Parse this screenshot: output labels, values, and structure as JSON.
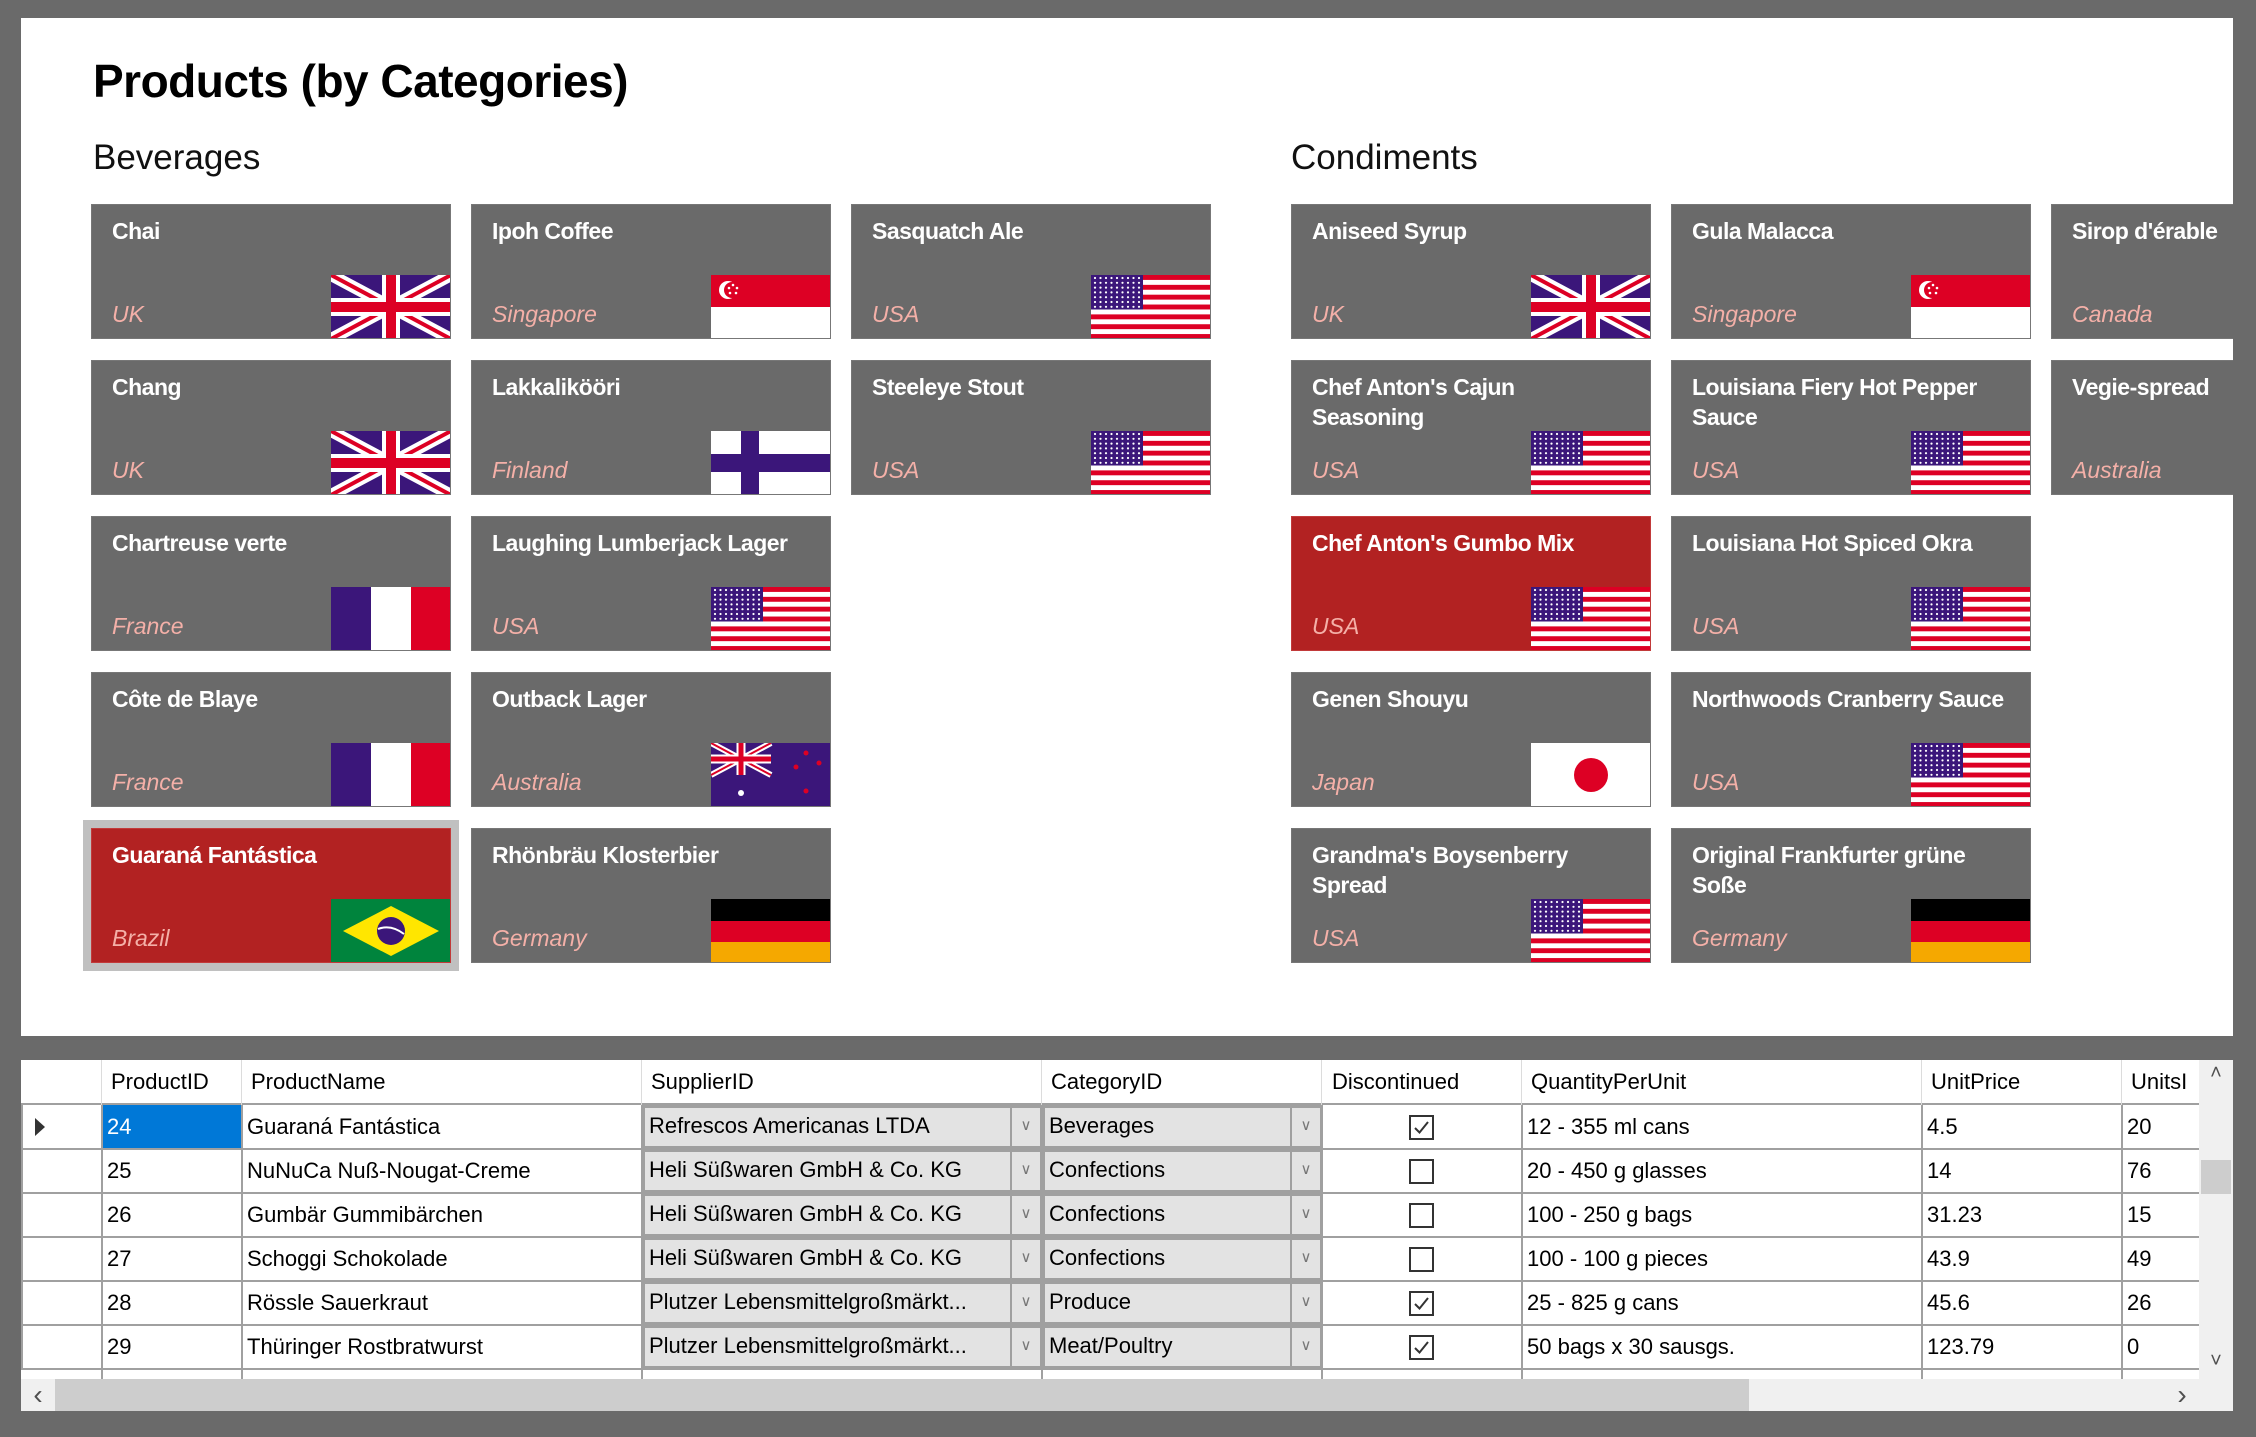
{
  "page": {
    "title": "Products (by Categories)"
  },
  "colors": {
    "tile_bg": "#6a6a6a",
    "tile_selected_bg": "#b22222",
    "tile_name": "#ffffff",
    "tile_country": "#f4b0a8",
    "selected_cell": "#0078d7",
    "window_bg": "#6a6a6a"
  },
  "categories": [
    {
      "name": "Beverages",
      "products": [
        {
          "name": "Chai",
          "country": "UK",
          "flag": "uk-flag-icon",
          "col": 0,
          "row": 0
        },
        {
          "name": "Chang",
          "country": "UK",
          "flag": "uk-flag-icon",
          "col": 0,
          "row": 1
        },
        {
          "name": "Chartreuse verte",
          "country": "France",
          "flag": "france-flag-icon",
          "col": 0,
          "row": 2
        },
        {
          "name": "Côte de Blaye",
          "country": "France",
          "flag": "france-flag-icon",
          "col": 0,
          "row": 3
        },
        {
          "name": "Guaraná Fantástica",
          "country": "Brazil",
          "flag": "brazil-flag-icon",
          "col": 0,
          "row": 4,
          "selected": true,
          "focused": true
        },
        {
          "name": "Ipoh Coffee",
          "country": "Singapore",
          "flag": "singapore-flag-icon",
          "col": 1,
          "row": 0
        },
        {
          "name": "Lakkalikööri",
          "country": "Finland",
          "flag": "finland-flag-icon",
          "col": 1,
          "row": 1
        },
        {
          "name": "Laughing Lumberjack Lager",
          "country": "USA",
          "flag": "usa-flag-icon",
          "col": 1,
          "row": 2
        },
        {
          "name": "Outback Lager",
          "country": "Australia",
          "flag": "australia-flag-icon",
          "col": 1,
          "row": 3
        },
        {
          "name": "Rhönbräu Klosterbier",
          "country": "Germany",
          "flag": "germany-flag-icon",
          "col": 1,
          "row": 4
        },
        {
          "name": "Sasquatch Ale",
          "country": "USA",
          "flag": "usa-flag-icon",
          "col": 2,
          "row": 0
        },
        {
          "name": "Steeleye Stout",
          "country": "USA",
          "flag": "usa-flag-icon",
          "col": 2,
          "row": 1
        }
      ]
    },
    {
      "name": "Condiments",
      "products": [
        {
          "name": "Aniseed Syrup",
          "country": "UK",
          "flag": "uk-flag-icon",
          "col": 0,
          "row": 0
        },
        {
          "name": "Chef Anton's Cajun Seasoning",
          "country": "USA",
          "flag": "usa-flag-icon",
          "col": 0,
          "row": 1
        },
        {
          "name": "Chef Anton's Gumbo Mix",
          "country": "USA",
          "flag": "usa-flag-icon",
          "col": 0,
          "row": 2,
          "selected": true
        },
        {
          "name": "Genen Shouyu",
          "country": "Japan",
          "flag": "japan-flag-icon",
          "col": 0,
          "row": 3
        },
        {
          "name": "Grandma's Boysenberry Spread",
          "country": "USA",
          "flag": "usa-flag-icon",
          "col": 0,
          "row": 4
        },
        {
          "name": "Gula Malacca",
          "country": "Singapore",
          "flag": "singapore-flag-icon",
          "col": 1,
          "row": 0
        },
        {
          "name": "Louisiana Fiery Hot Pepper Sauce",
          "country": "USA",
          "flag": "usa-flag-icon",
          "col": 1,
          "row": 1
        },
        {
          "name": "Louisiana Hot Spiced Okra",
          "country": "USA",
          "flag": "usa-flag-icon",
          "col": 1,
          "row": 2
        },
        {
          "name": "Northwoods Cranberry Sauce",
          "country": "USA",
          "flag": "usa-flag-icon",
          "col": 1,
          "row": 3
        },
        {
          "name": "Original Frankfurter grüne Soße",
          "country": "Germany",
          "flag": "germany-flag-icon",
          "col": 1,
          "row": 4
        },
        {
          "name": "Sirop d'érable",
          "country": "Canada",
          "flag": "canada-flag-icon",
          "col": 2,
          "row": 0
        },
        {
          "name": "Vegie-spread",
          "country": "Australia",
          "flag": "australia-flag-icon",
          "col": 2,
          "row": 1
        }
      ]
    }
  ],
  "grid": {
    "columns": [
      "",
      "ProductID",
      "ProductName",
      "SupplierID",
      "CategoryID",
      "Discontinued",
      "QuantityPerUnit",
      "UnitPrice",
      "UnitsI"
    ],
    "current_row": 0,
    "rows": [
      {
        "ProductID": "24",
        "ProductName": "Guaraná Fantástica",
        "SupplierID": "Refrescos Americanas LTDA",
        "CategoryID": "Beverages",
        "Discontinued": true,
        "QuantityPerUnit": "12 - 355 ml cans",
        "UnitPrice": "4.5",
        "UnitsInStock": "20"
      },
      {
        "ProductID": "25",
        "ProductName": "NuNuCa Nuß-Nougat-Creme",
        "SupplierID": "Heli Süßwaren GmbH & Co. KG",
        "CategoryID": "Confections",
        "Discontinued": false,
        "QuantityPerUnit": "20 - 450 g glasses",
        "UnitPrice": "14",
        "UnitsInStock": "76"
      },
      {
        "ProductID": "26",
        "ProductName": "Gumbär Gummibärchen",
        "SupplierID": "Heli Süßwaren GmbH & Co. KG",
        "CategoryID": "Confections",
        "Discontinued": false,
        "QuantityPerUnit": "100 - 250 g bags",
        "UnitPrice": "31.23",
        "UnitsInStock": "15"
      },
      {
        "ProductID": "27",
        "ProductName": "Schoggi Schokolade",
        "SupplierID": "Heli Süßwaren GmbH & Co. KG",
        "CategoryID": "Confections",
        "Discontinued": false,
        "QuantityPerUnit": "100 - 100 g pieces",
        "UnitPrice": "43.9",
        "UnitsInStock": "49"
      },
      {
        "ProductID": "28",
        "ProductName": "Rössle Sauerkraut",
        "SupplierID": "Plutzer Lebensmittelgroßmärkt...",
        "CategoryID": "Produce",
        "Discontinued": true,
        "QuantityPerUnit": "25 - 825 g cans",
        "UnitPrice": "45.6",
        "UnitsInStock": "26"
      },
      {
        "ProductID": "29",
        "ProductName": "Thüringer Rostbratwurst",
        "SupplierID": "Plutzer Lebensmittelgroßmärkt...",
        "CategoryID": "Meat/Poultry",
        "Discontinued": true,
        "QuantityPerUnit": "50 bags x 30 sausgs.",
        "UnitPrice": "123.79",
        "UnitsInStock": "0"
      }
    ],
    "scroll": {
      "up_icon": "chevron-up-icon",
      "down_icon": "chevron-down-icon",
      "left_icon": "chevron-left-icon",
      "right_icon": "chevron-right-icon",
      "up_glyph": "˄",
      "down_glyph": "˅",
      "left_glyph": "‹",
      "right_glyph": "›",
      "vertical_position": 0.3,
      "horizontal_visible_fraction": 0.79
    },
    "combo_arrow_glyph": "∨"
  }
}
